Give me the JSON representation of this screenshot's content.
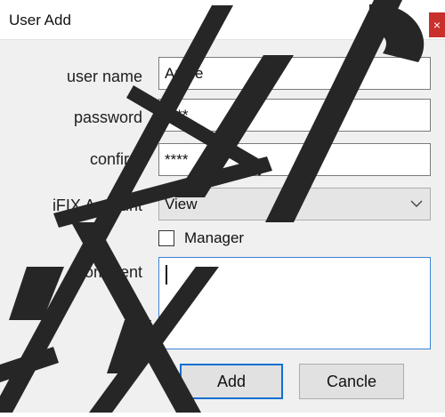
{
  "window": {
    "title": "User Add",
    "close_label": "×"
  },
  "form": {
    "username_label": "user name",
    "username_value": "Annie",
    "password_label": "password",
    "password_value": "****",
    "confirm_label": "confirm",
    "confirm_value": "****",
    "account_label": "iFIX Account",
    "account_selected": "View",
    "manager_label": "Manager",
    "manager_checked": false,
    "comment_label": "comment",
    "comment_value": ""
  },
  "buttons": {
    "add_label": "Add",
    "cancel_label": "Cancle"
  },
  "colors": {
    "focus_accent": "#3c82d6",
    "default_button_border": "#0f70d2",
    "close_button": "#c9302c",
    "watermark": "#262626"
  }
}
